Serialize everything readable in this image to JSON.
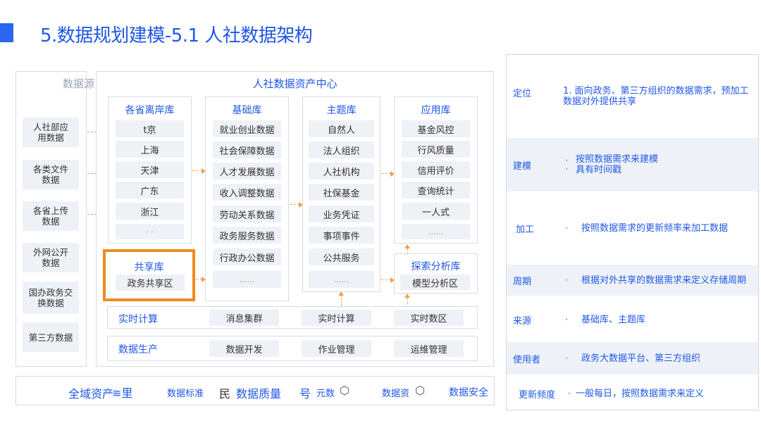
{
  "title": "5.数据规划建模-5.1 人社数据架构",
  "source": {
    "label": "数据源",
    "items": [
      "人社部应用数据",
      "各类文件数据",
      "各省上传数据",
      "外网公开数据",
      "国办政务交换数据",
      "第三方数据"
    ]
  },
  "center": {
    "title": "人社数据资产中心",
    "columns": [
      {
        "header": "各省离岸库",
        "items": [
          "t京",
          "上海",
          "天津",
          "广东",
          "浙江",
          "·  ·"
        ]
      },
      {
        "header": "基础库",
        "items": [
          "就业创业数据",
          "社会保障数据",
          "人才发展数据",
          "收入调整数据",
          "劳动关系数据",
          "政务服务数据",
          "行政办公数据",
          "……"
        ]
      },
      {
        "header": "主题库",
        "items": [
          "自然人",
          "法人组织",
          "人社机构",
          "社保基金",
          "业务凭证",
          "事项事件",
          "公共服务",
          "……"
        ]
      },
      {
        "header": "应用库",
        "items": [
          "基金风控",
          "行风质量",
          "信用评价",
          "查询统计",
          "一人式",
          "……"
        ]
      }
    ],
    "share": {
      "title": "共享库",
      "item": "政务共享区"
    },
    "explore": {
      "title": "探索分析库",
      "item": "模型分析区"
    },
    "realtime": {
      "label": "实时计算",
      "items": [
        "消息集群",
        "实时计算",
        "实时数区"
      ]
    },
    "production": {
      "label": "数据生产",
      "items": [
        "数据开发",
        "作业管理",
        "运维管理"
      ]
    }
  },
  "bottom_strip": [
    "全域资产",
    "≋里",
    "数据标准",
    "民",
    "数据质量",
    "号",
    "元数",
    "⬡",
    "数据资",
    "⬡",
    "数据安全"
  ],
  "right_panel": [
    {
      "key": "定位",
      "bullet": "",
      "value": "1. 面向政务、第三方组织的数据需求，预加工数据对外提供共享"
    },
    {
      "key": "建模",
      "bullet": "·\n·",
      "value": "按照数据需求来建模\n具有时间戳"
    },
    {
      "key": "加工",
      "bullet": "·",
      "value": "按照数据需求的更新频率来加工数据"
    },
    {
      "key": "周期",
      "bullet": "·",
      "value": "根据对外共享的数据需求来定义存储周期"
    },
    {
      "key": "来源",
      "bullet": "·",
      "value": "基础库、主题库"
    },
    {
      "key": "使用者",
      "bullet": "·",
      "value": "政务大数据平台、第三方组织"
    },
    {
      "key": "更新频度",
      "bullet": "·",
      "value": "一般每日，按照数据需求来定义"
    }
  ],
  "colors": {
    "accent": "#1f58e6",
    "highlight": "#f28a1e",
    "cell": "#eef1f6"
  }
}
